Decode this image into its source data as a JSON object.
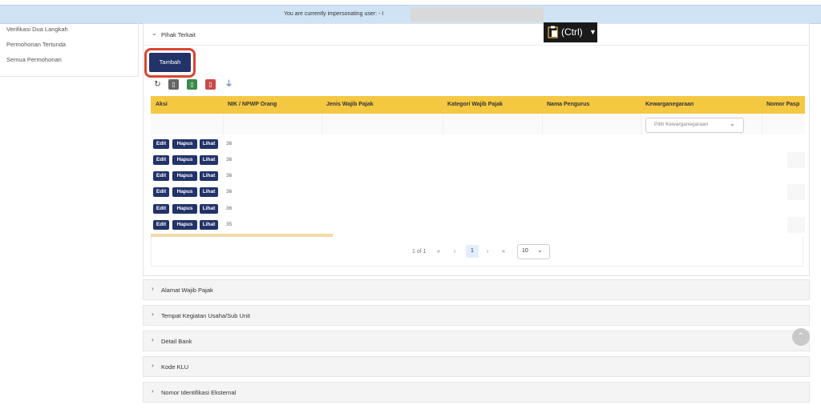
{
  "banner": {
    "text": "You are currently impersonating user: - I"
  },
  "clipboard": {
    "label": "(Ctrl)",
    "icon": "clipboard-icon"
  },
  "sidebar": {
    "items": [
      {
        "label": "Verifikasi Dua Langkah"
      },
      {
        "label": "Permohonan Tertunda"
      },
      {
        "label": "Semua Permohonan"
      }
    ]
  },
  "section": {
    "title": "Pihak Terkait",
    "add_label": "Tambah"
  },
  "toolbar": {
    "icons": [
      "refresh-icon",
      "file-icon",
      "excel-icon",
      "pdf-icon",
      "filter-icon"
    ]
  },
  "table": {
    "columns": [
      "Aksi",
      "NIK / NPWP Orang",
      "Jenis Wajib Pajak",
      "Kategori Wajib Pajak",
      "Nama Pengurus",
      "Kewarganegaraan",
      "Nomor Pasp"
    ],
    "filter_placeholder": "Pilih Kewarganegaraan",
    "action_labels": {
      "edit": "Edit",
      "delete": "Hapus",
      "view": "Lihat"
    },
    "rows": [
      {
        "nik": "36"
      },
      {
        "nik": "36"
      },
      {
        "nik": "36"
      },
      {
        "nik": "36"
      },
      {
        "nik": "36"
      },
      {
        "nik": "35"
      }
    ]
  },
  "pagination": {
    "summary": "1 of 1",
    "first": "«",
    "prev": "‹",
    "current": "1",
    "next": "›",
    "last": "»",
    "page_size": "10"
  },
  "accordions": [
    {
      "title": "Alamat Wajib Pajak"
    },
    {
      "title": "Tempat Kegiatan Usaha/Sub Unit"
    },
    {
      "title": "Detail Bank"
    },
    {
      "title": "Kode KLU"
    },
    {
      "title": "Nomor Identifikasi Eksternal"
    }
  ],
  "colors": {
    "primary": "#22336a",
    "table_header": "#f5c842",
    "banner": "#cfe3f5",
    "highlight": "#d9462f"
  }
}
